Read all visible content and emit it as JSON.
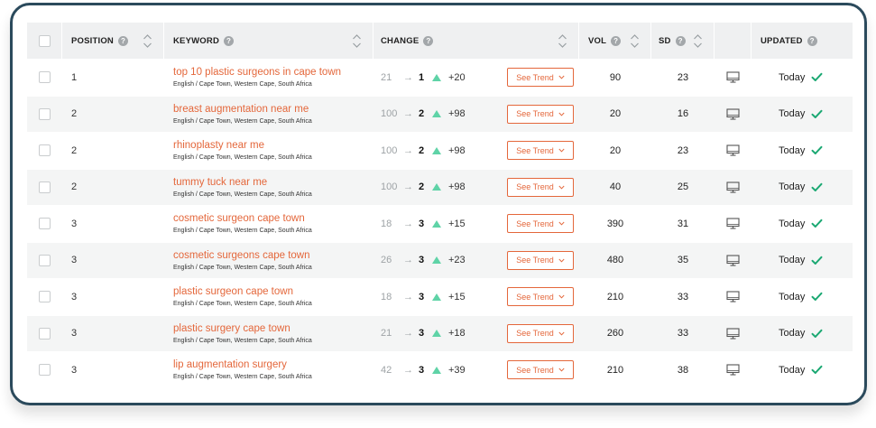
{
  "headers": {
    "position": "POSITION",
    "keyword": "KEYWORD",
    "change": "CHANGE",
    "vol": "VOL",
    "sd": "SD",
    "updated": "UPDATED",
    "help_glyph": "?"
  },
  "colors": {
    "accent": "#e4673b",
    "up": "#5fd3a7",
    "check": "#1aa872",
    "frame": "#2b4a5c"
  },
  "icons": {
    "sort": "sort-icon",
    "device": "desktop-icon",
    "trend_up": "triangle-up-icon",
    "updated": "checkmark-icon",
    "chevron": "chevron-down-icon"
  },
  "arrow_glyph": "→",
  "rows": [
    {
      "position": "1",
      "keyword": "top 10 plastic surgeons in cape town",
      "location": "English / Cape Town, Western Cape, South Africa",
      "old": "21",
      "new": "1",
      "delta": "+20",
      "trend_label": "See Trend",
      "vol": "90",
      "sd": "23",
      "updated": "Today"
    },
    {
      "position": "2",
      "keyword": "breast augmentation near me",
      "location": "English / Cape Town, Western Cape, South Africa",
      "old": "100",
      "new": "2",
      "delta": "+98",
      "trend_label": "See Trend",
      "vol": "20",
      "sd": "16",
      "updated": "Today"
    },
    {
      "position": "2",
      "keyword": "rhinoplasty near me",
      "location": "English / Cape Town, Western Cape, South Africa",
      "old": "100",
      "new": "2",
      "delta": "+98",
      "trend_label": "See Trend",
      "vol": "20",
      "sd": "23",
      "updated": "Today"
    },
    {
      "position": "2",
      "keyword": "tummy tuck near me",
      "location": "English / Cape Town, Western Cape, South Africa",
      "old": "100",
      "new": "2",
      "delta": "+98",
      "trend_label": "See Trend",
      "vol": "40",
      "sd": "25",
      "updated": "Today"
    },
    {
      "position": "3",
      "keyword": "cosmetic surgeon cape town",
      "location": "English / Cape Town, Western Cape, South Africa",
      "old": "18",
      "new": "3",
      "delta": "+15",
      "trend_label": "See Trend",
      "vol": "390",
      "sd": "31",
      "updated": "Today"
    },
    {
      "position": "3",
      "keyword": "cosmetic surgeons cape town",
      "location": "English / Cape Town, Western Cape, South Africa",
      "old": "26",
      "new": "3",
      "delta": "+23",
      "trend_label": "See Trend",
      "vol": "480",
      "sd": "35",
      "updated": "Today"
    },
    {
      "position": "3",
      "keyword": "plastic surgeon cape town",
      "location": "English / Cape Town, Western Cape, South Africa",
      "old": "18",
      "new": "3",
      "delta": "+15",
      "trend_label": "See Trend",
      "vol": "210",
      "sd": "33",
      "updated": "Today"
    },
    {
      "position": "3",
      "keyword": "plastic surgery cape town",
      "location": "English / Cape Town, Western Cape, South Africa",
      "old": "21",
      "new": "3",
      "delta": "+18",
      "trend_label": "See Trend",
      "vol": "260",
      "sd": "33",
      "updated": "Today"
    },
    {
      "position": "3",
      "keyword": "lip augmentation surgery",
      "location": "English / Cape Town, Western Cape, South Africa",
      "old": "42",
      "new": "3",
      "delta": "+39",
      "trend_label": "See Trend",
      "vol": "210",
      "sd": "38",
      "updated": "Today"
    }
  ]
}
